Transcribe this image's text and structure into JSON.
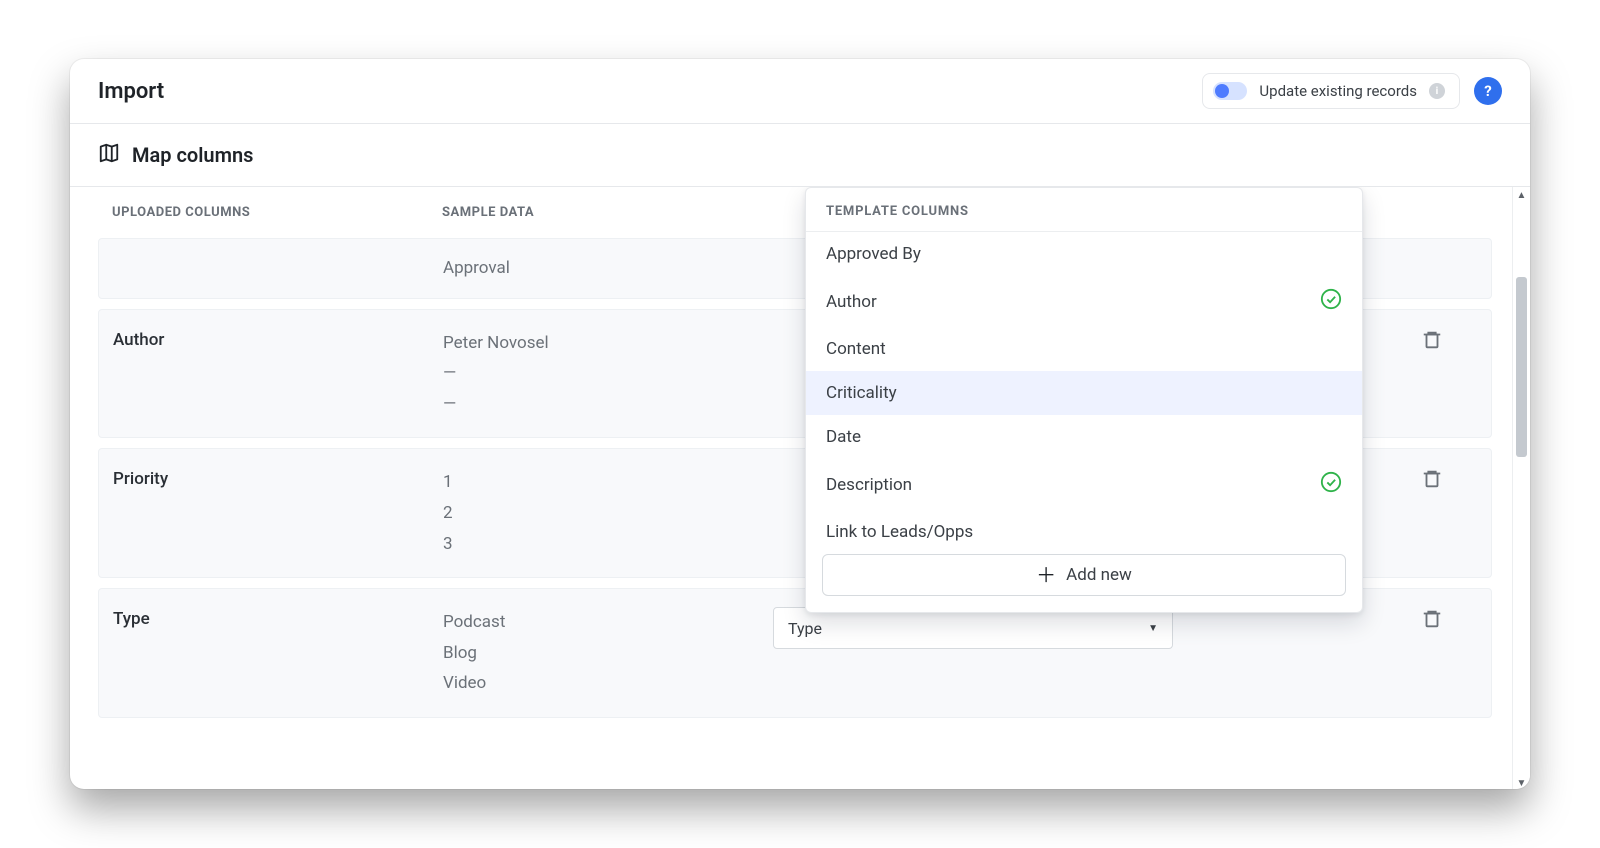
{
  "header": {
    "title": "Import",
    "toggle_label": "Update existing records"
  },
  "subheader": {
    "title": "Map columns"
  },
  "table": {
    "hdr_uploaded": "UPLOADED COLUMNS",
    "hdr_sample": "SAMPLE DATA"
  },
  "rows": [
    {
      "name": "",
      "samples": [
        "Approval"
      ],
      "dest": null
    },
    {
      "name": "Author",
      "samples": [
        "Peter Novosel",
        "—",
        "—"
      ],
      "dest": null
    },
    {
      "name": "Priority",
      "samples": [
        "1",
        "2",
        "3"
      ],
      "dest": null
    },
    {
      "name": "Type",
      "samples": [
        "Podcast",
        "Blog",
        "Video"
      ],
      "dest": "Type"
    }
  ],
  "dropdown": {
    "title": "TEMPLATE COLUMNS",
    "items": [
      {
        "label": "Approved By",
        "checked": false,
        "highlighted": false
      },
      {
        "label": "Author",
        "checked": true,
        "highlighted": false
      },
      {
        "label": "Content",
        "checked": false,
        "highlighted": false
      },
      {
        "label": "Criticality",
        "checked": false,
        "highlighted": true
      },
      {
        "label": "Date",
        "checked": false,
        "highlighted": false
      },
      {
        "label": "Description",
        "checked": true,
        "highlighted": false
      },
      {
        "label": "Link to Leads/Opps",
        "checked": false,
        "highlighted": false
      }
    ],
    "add_new": "Add new"
  }
}
